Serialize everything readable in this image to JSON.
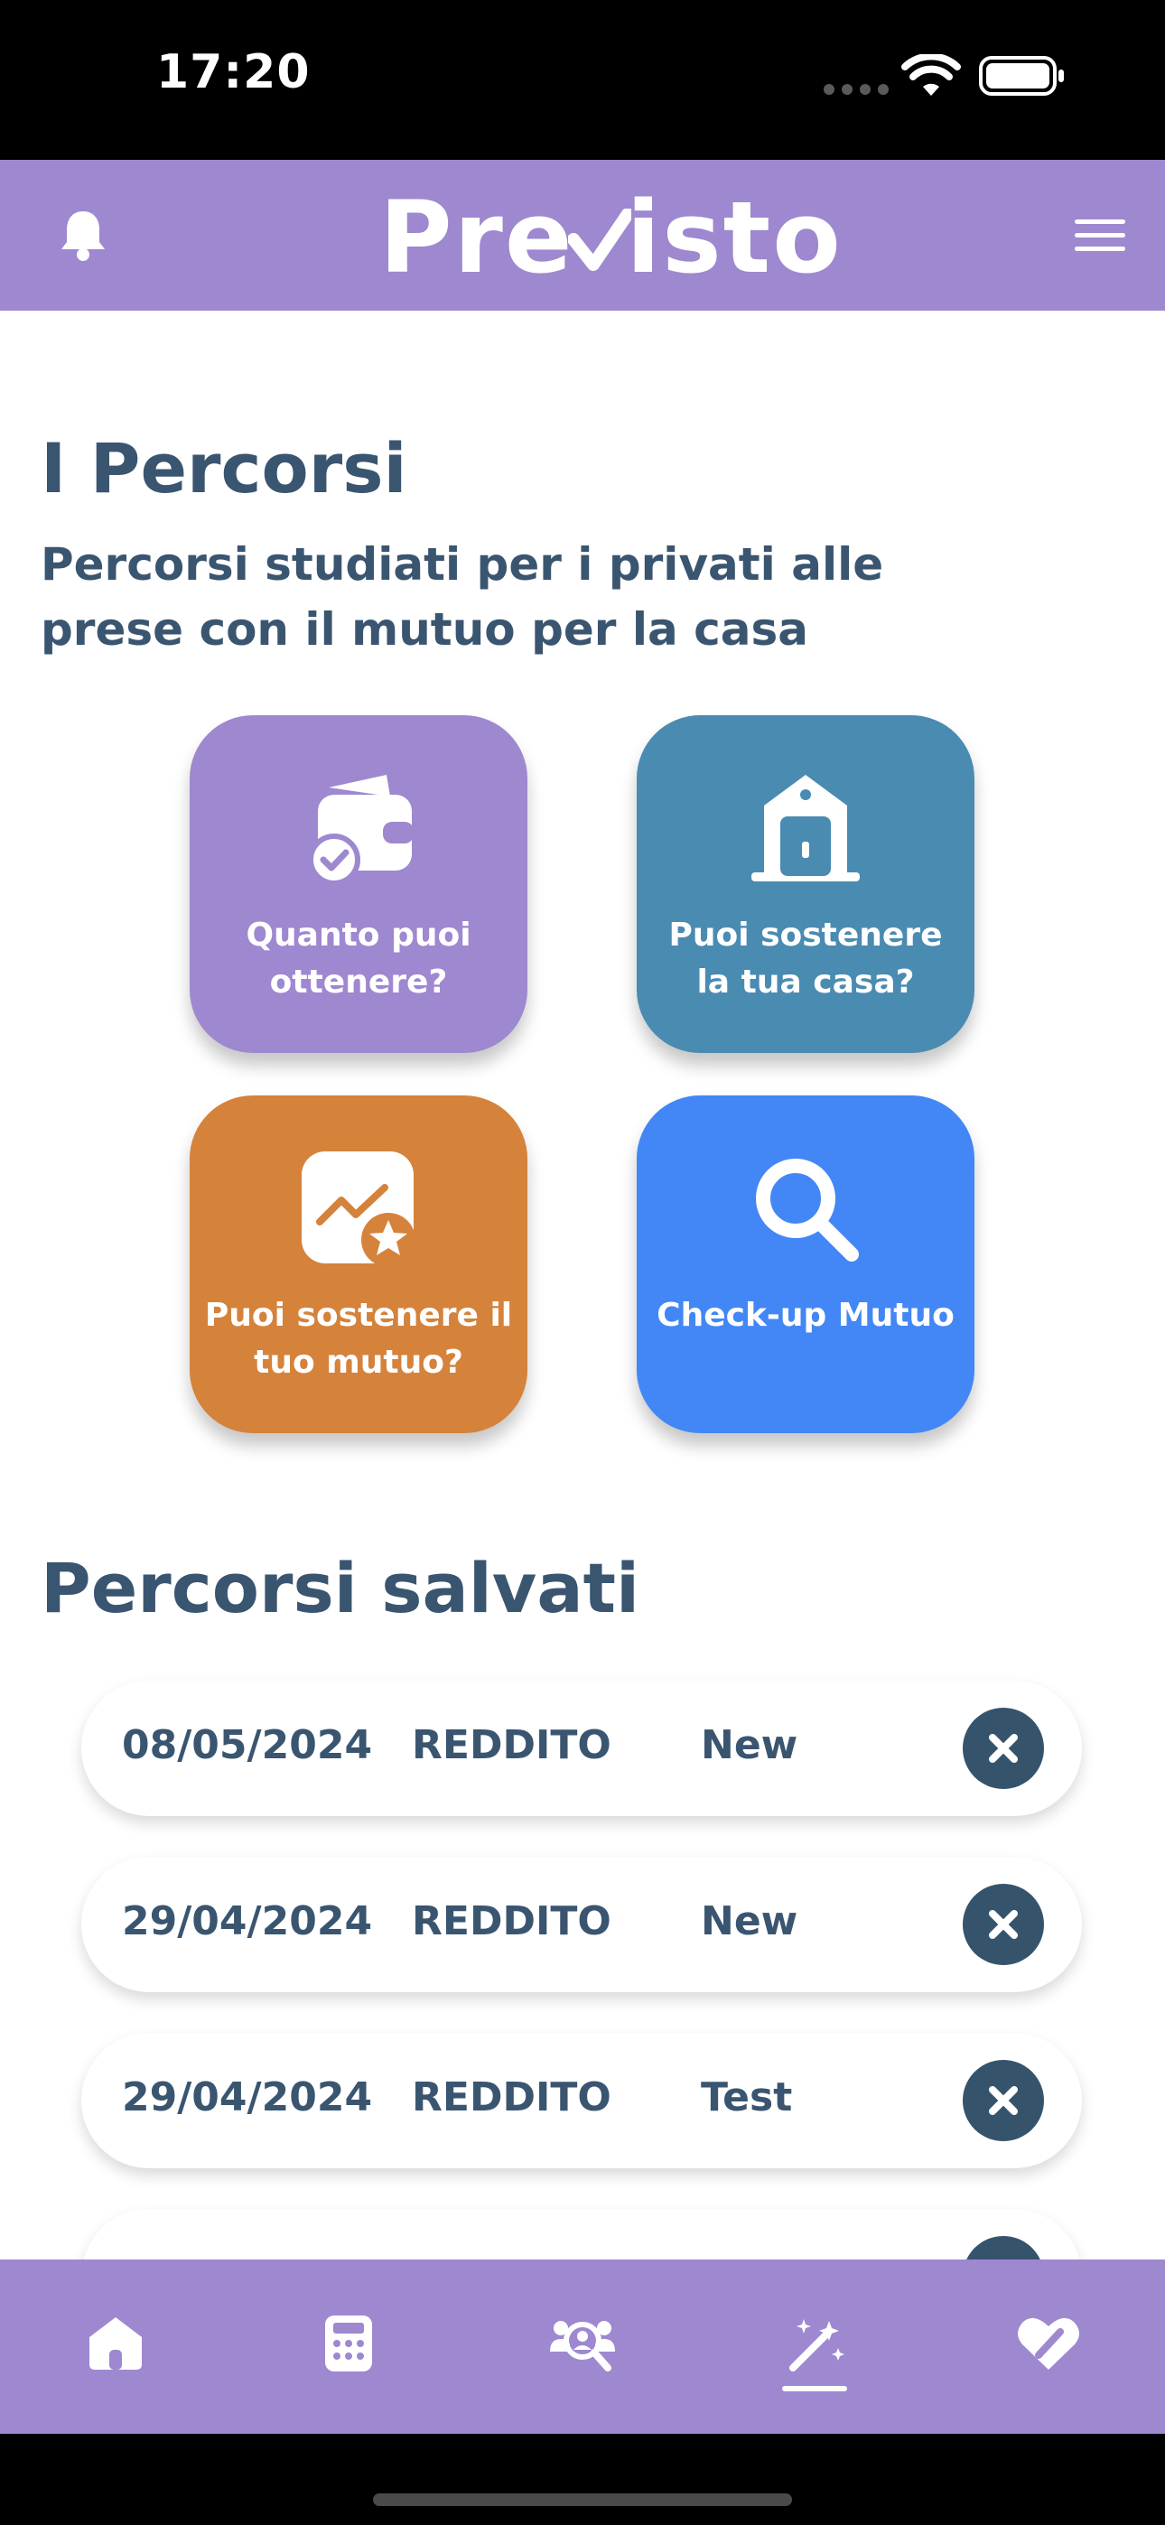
{
  "status_bar": {
    "time": "17:20"
  },
  "header": {
    "logo_pre": "Pre",
    "logo_post": "isto",
    "logo_full": "Previsto"
  },
  "main": {
    "title": "I Percorsi",
    "subtitle": "Percorsi studiati per i privati alle prese con il mutuo per la casa",
    "tiles": [
      {
        "label": "Quanto puoi ottenere?",
        "color": "#9e88cf",
        "icon": "wallet-check-icon"
      },
      {
        "label": "Puoi sostenere la tua casa?",
        "color": "#4a8bb2",
        "icon": "house-icon"
      },
      {
        "label": "Puoi sostenere il tuo mutuo?",
        "color": "#d5823b",
        "icon": "chart-star-icon"
      },
      {
        "label": "Check-up Mutuo",
        "color": "#4287f5",
        "icon": "search-icon"
      }
    ],
    "saved_title": "Percorsi salvati",
    "saved": [
      {
        "date": "08/05/2024",
        "type": "REDDITO",
        "name": "New"
      },
      {
        "date": "29/04/2024",
        "type": "REDDITO",
        "name": "New"
      },
      {
        "date": "29/04/2024",
        "type": "REDDITO",
        "name": "Test"
      },
      {
        "date": "",
        "type": "",
        "name": ""
      }
    ]
  },
  "bottom_nav": {
    "items": [
      {
        "icon": "home-icon"
      },
      {
        "icon": "calculator-icon"
      },
      {
        "icon": "people-search-icon"
      },
      {
        "icon": "magic-wand-icon",
        "active": true
      },
      {
        "icon": "heart-edit-icon"
      }
    ]
  },
  "colors": {
    "brand": "#9e88cf",
    "text": "#3a5570",
    "delete": "#36536c"
  }
}
